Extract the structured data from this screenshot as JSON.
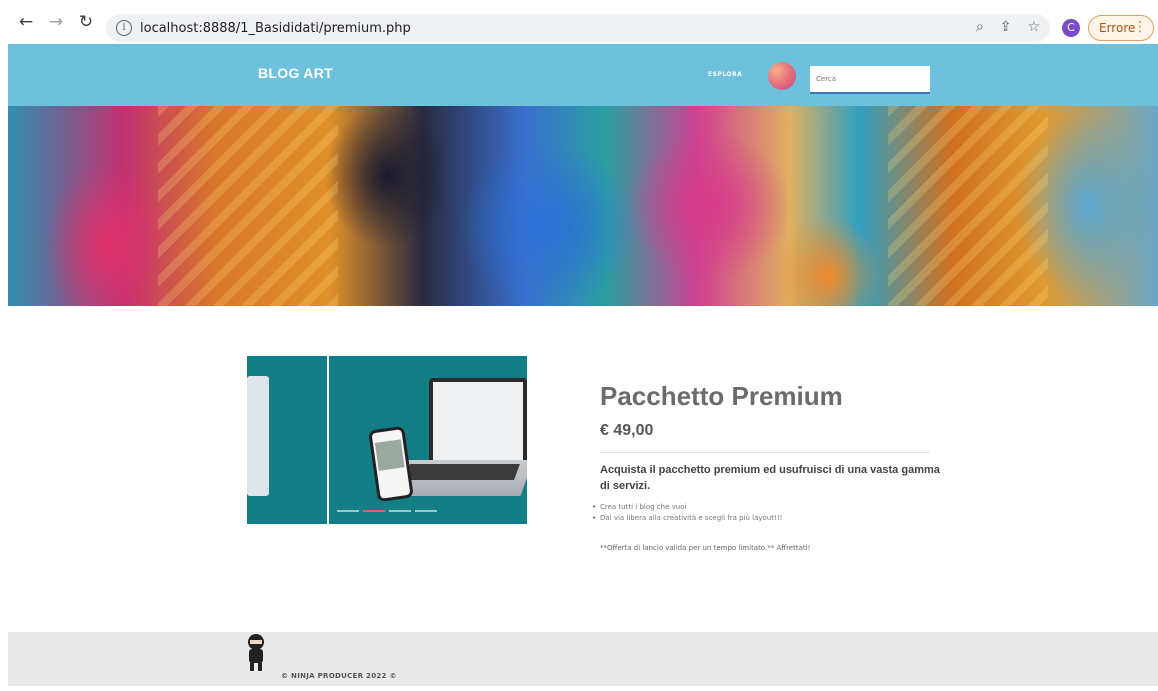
{
  "browser": {
    "url": "localhost:8888/1_Basididati/premium.php",
    "profile_initial": "C",
    "error_label": "Errore"
  },
  "header": {
    "brand": "BLOG ART",
    "nav_explore": "ESPLORA",
    "search_placeholder": "Cerca"
  },
  "product": {
    "title": "Pacchetto Premium",
    "price": "€ 49,00",
    "description": "Acquista il pacchetto premium ed usufruisci di una vasta gamma di servizi.",
    "features": [
      "Crea tutti i blog che vuoi",
      "Dai via libera alla creatività e scegli fra più layout!!!"
    ],
    "offer": "**Offerta di lancio valida per un tempo limitato.** Affrettati!"
  },
  "footer": {
    "copyright": "© NINJA PRODUCER 2022 ©"
  }
}
